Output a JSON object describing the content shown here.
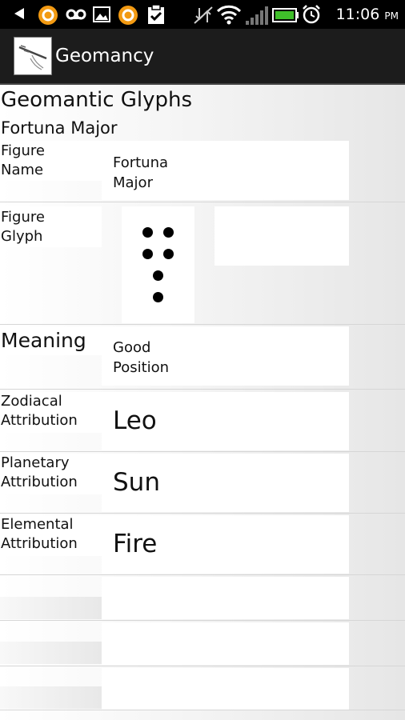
{
  "status_bar": {
    "time": "11:06",
    "ampm": "PM"
  },
  "app": {
    "title": "Geomancy"
  },
  "page": {
    "heading": "Geomantic Glyphs",
    "subheading": "Fortuna Major"
  },
  "rows": {
    "figure_name": {
      "label_line1": "Figure",
      "label_line2": "Name",
      "value_line1": "Fortuna",
      "value_line2": "Major"
    },
    "figure_glyph": {
      "label_line1": "Figure",
      "label_line2": "Glyph",
      "dots_per_row": [
        2,
        2,
        1,
        1
      ]
    },
    "meaning": {
      "label": "Meaning",
      "value_line1": "Good",
      "value_line2": "Position"
    },
    "zodiacal": {
      "label_line1": "Zodiacal",
      "label_line2": "Attribution",
      "value": "Leo"
    },
    "planetary": {
      "label_line1": "Planetary",
      "label_line2": "Attribution",
      "value": "Sun"
    },
    "elemental": {
      "label_line1": "Elemental",
      "label_line2": "Attribution",
      "value": "Fire"
    }
  }
}
